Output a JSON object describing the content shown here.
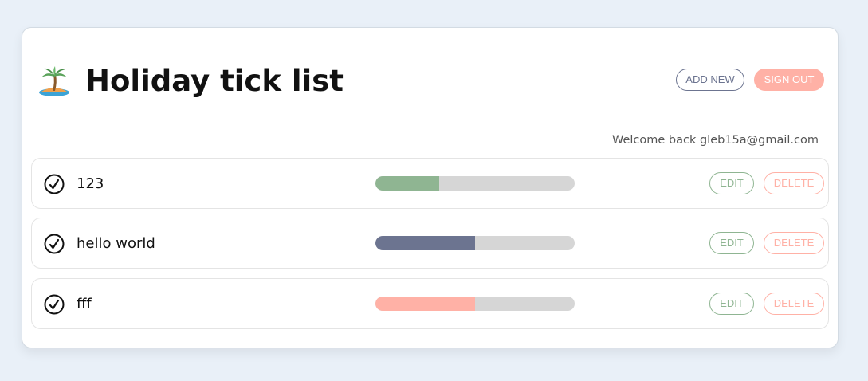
{
  "header": {
    "title": "Holiday tick list",
    "logo_icon": "palm-tree-island-icon",
    "add_new_label": "ADD NEW",
    "sign_out_label": "SIGN OUT"
  },
  "welcome_text": "Welcome back gleb15a@gmail.com",
  "colors": {
    "accent_green": "#8fb592",
    "accent_slate": "#6c7490",
    "accent_salmon": "#ffb1a6"
  },
  "items": [
    {
      "label": "123",
      "progress": 0.32,
      "bar_color": "#8fb592",
      "check_icon": "check-circle-icon",
      "edit_label": "EDIT",
      "delete_label": "DELETE"
    },
    {
      "label": "hello world",
      "progress": 0.5,
      "bar_color": "#6c7490",
      "check_icon": "check-circle-icon",
      "edit_label": "EDIT",
      "delete_label": "DELETE"
    },
    {
      "label": "fff",
      "progress": 0.5,
      "bar_color": "#ffb1a6",
      "check_icon": "check-circle-icon",
      "edit_label": "EDIT",
      "delete_label": "DELETE"
    }
  ]
}
